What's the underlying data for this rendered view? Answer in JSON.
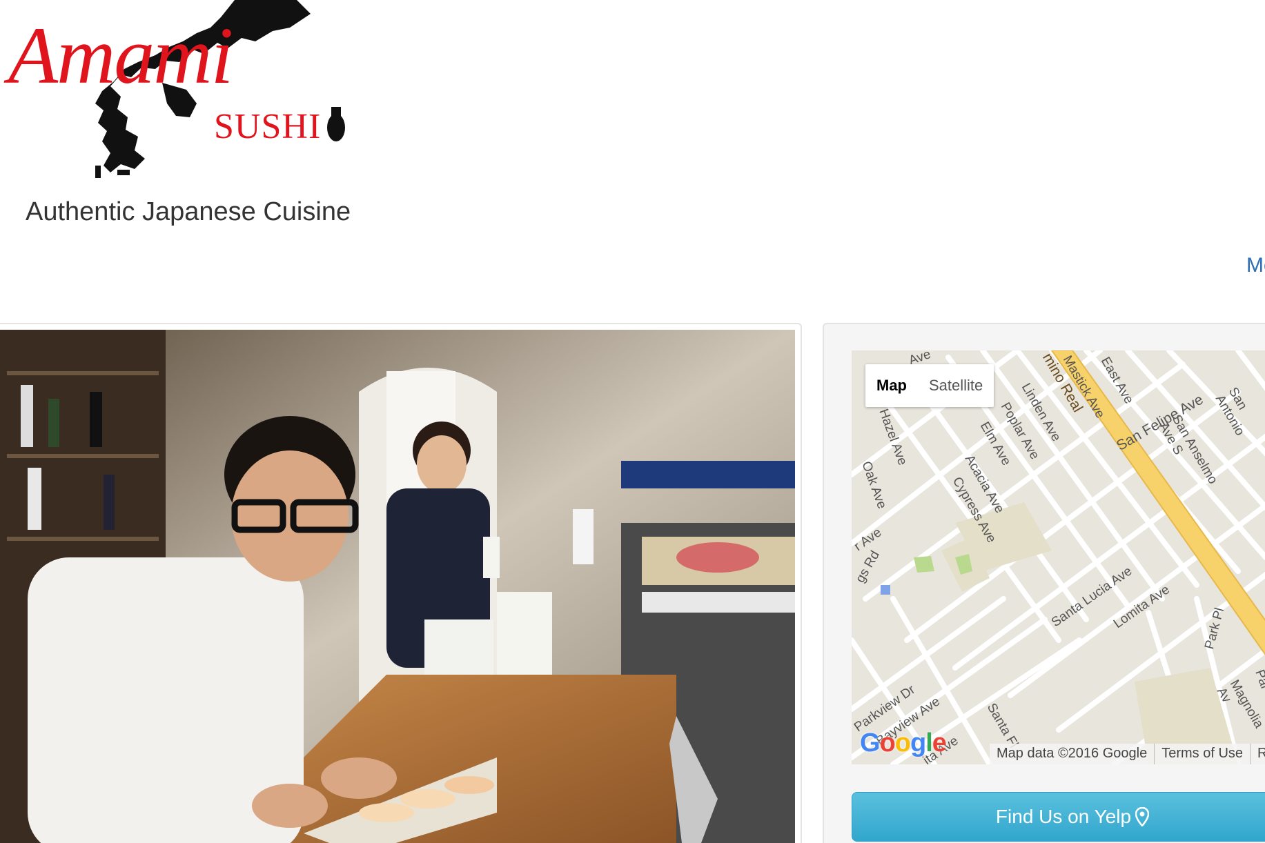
{
  "brand": {
    "logo_script": "Amami",
    "logo_sub": "SUSHI",
    "tagline": "Authentic Japanese Cuisine",
    "logo_red": "#e0141c"
  },
  "nav": {
    "partial_link": "Mo"
  },
  "photo": {
    "alt": "Sushi chef plating nigiri at the sushi bar"
  },
  "map": {
    "type_options": [
      "Map",
      "Satellite"
    ],
    "selected_type": "Map",
    "streets": [
      "Oak Ave",
      "Hazel Ave",
      "Elm Ave",
      "Acacia Ave",
      "Cypress Ave",
      "Poplar Ave",
      "Linden Ave",
      "Mastick Ave",
      "East Ave",
      "San Felipe Ave",
      "San Anselmo Ave S",
      "San Antonio",
      "mino Real",
      "Santa Lucia Ave",
      "Lomita Ave",
      "Park Pl",
      "Magnolia Av",
      "Parkview Dr",
      "Bayview Ave",
      "Santa Fl",
      "ita Ave",
      "r Ave",
      "gs Rd",
      "Ave",
      "Pal"
    ],
    "attribution": "Map data ©2016 Google",
    "terms": "Terms of Use",
    "report": "R",
    "google_letters": [
      "G",
      "o",
      "o",
      "g",
      "l",
      "e"
    ],
    "google_colors": [
      "#4285f4",
      "#ea4335",
      "#fbbc05",
      "#4285f4",
      "#34a853",
      "#ea4335"
    ]
  },
  "yelp": {
    "label": "Find Us on Yelp",
    "icon": "map-marker-icon"
  }
}
